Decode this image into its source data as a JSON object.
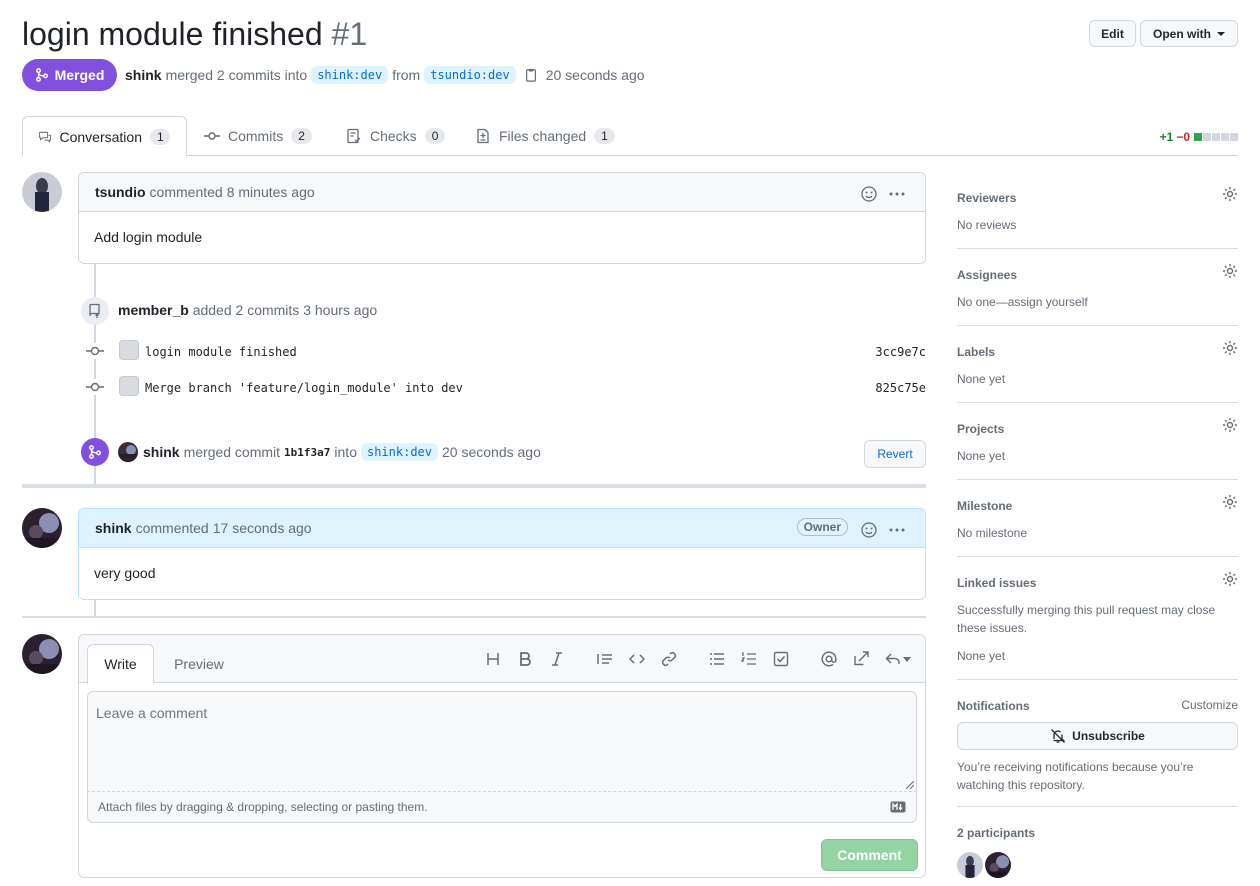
{
  "pr": {
    "title": "login module finished",
    "number": "#1",
    "state_label": "Merged",
    "author": "shink",
    "merged_text": "merged 2 commits into",
    "base_branch": "shink:dev",
    "from_text": "from",
    "head_branch": "tsundio:dev",
    "time": "20 seconds ago"
  },
  "header_buttons": {
    "edit": "Edit",
    "open_with": "Open with"
  },
  "tabs": [
    {
      "label": "Conversation",
      "count": "1",
      "icon": "comment-discussion-icon"
    },
    {
      "label": "Commits",
      "count": "2",
      "icon": "git-commit-icon"
    },
    {
      "label": "Checks",
      "count": "0",
      "icon": "checklist-icon"
    },
    {
      "label": "Files changed",
      "count": "1",
      "icon": "file-diff-icon"
    }
  ],
  "diffstat": {
    "additions": "+1",
    "deletions": "−0",
    "add_color": "#1a7f37",
    "del_color": "#cf222e",
    "blocks_green": 1,
    "blocks_total": 5
  },
  "comment1": {
    "author": "tsundio",
    "action": "commented",
    "time": "8 minutes ago",
    "body": "Add login module"
  },
  "push_event": {
    "author": "member_b",
    "action": "added 2 commits",
    "time": "3 hours ago"
  },
  "commits": [
    {
      "message": "login module finished",
      "sha": "3cc9e7c"
    },
    {
      "message": "Merge branch 'feature/login_module' into dev",
      "sha": "825c75e"
    }
  ],
  "merge_event": {
    "author": "shink",
    "action": "merged commit",
    "sha": "1b1f3a7",
    "into": "into",
    "branch": "shink:dev",
    "time": "20 seconds ago",
    "revert": "Revert"
  },
  "comment2": {
    "author": "shink",
    "action": "commented",
    "time": "17 seconds ago",
    "badge": "Owner",
    "body": "very good"
  },
  "editor": {
    "tab_write": "Write",
    "tab_preview": "Preview",
    "placeholder": "Leave a comment",
    "attach_text": "Attach files by dragging & dropping, selecting or pasting them.",
    "submit": "Comment"
  },
  "sidebar": {
    "reviewers": {
      "heading": "Reviewers",
      "value": "No reviews"
    },
    "assignees": {
      "heading": "Assignees",
      "value": "No one—assign yourself"
    },
    "labels": {
      "heading": "Labels",
      "value": "None yet"
    },
    "projects": {
      "heading": "Projects",
      "value": "None yet"
    },
    "milestone": {
      "heading": "Milestone",
      "value": "No milestone"
    },
    "linked": {
      "heading": "Linked issues",
      "desc": "Successfully merging this pull request may close these issues.",
      "value": "None yet"
    },
    "notifications": {
      "heading": "Notifications",
      "customize": "Customize",
      "button": "Unsubscribe",
      "desc": "You’re receiving notifications because you’re watching this repository."
    },
    "participants": {
      "heading": "2 participants"
    }
  },
  "colors": {
    "merged": "#8250df",
    "link": "#0969da",
    "comment_btn": "#94d3a2"
  }
}
